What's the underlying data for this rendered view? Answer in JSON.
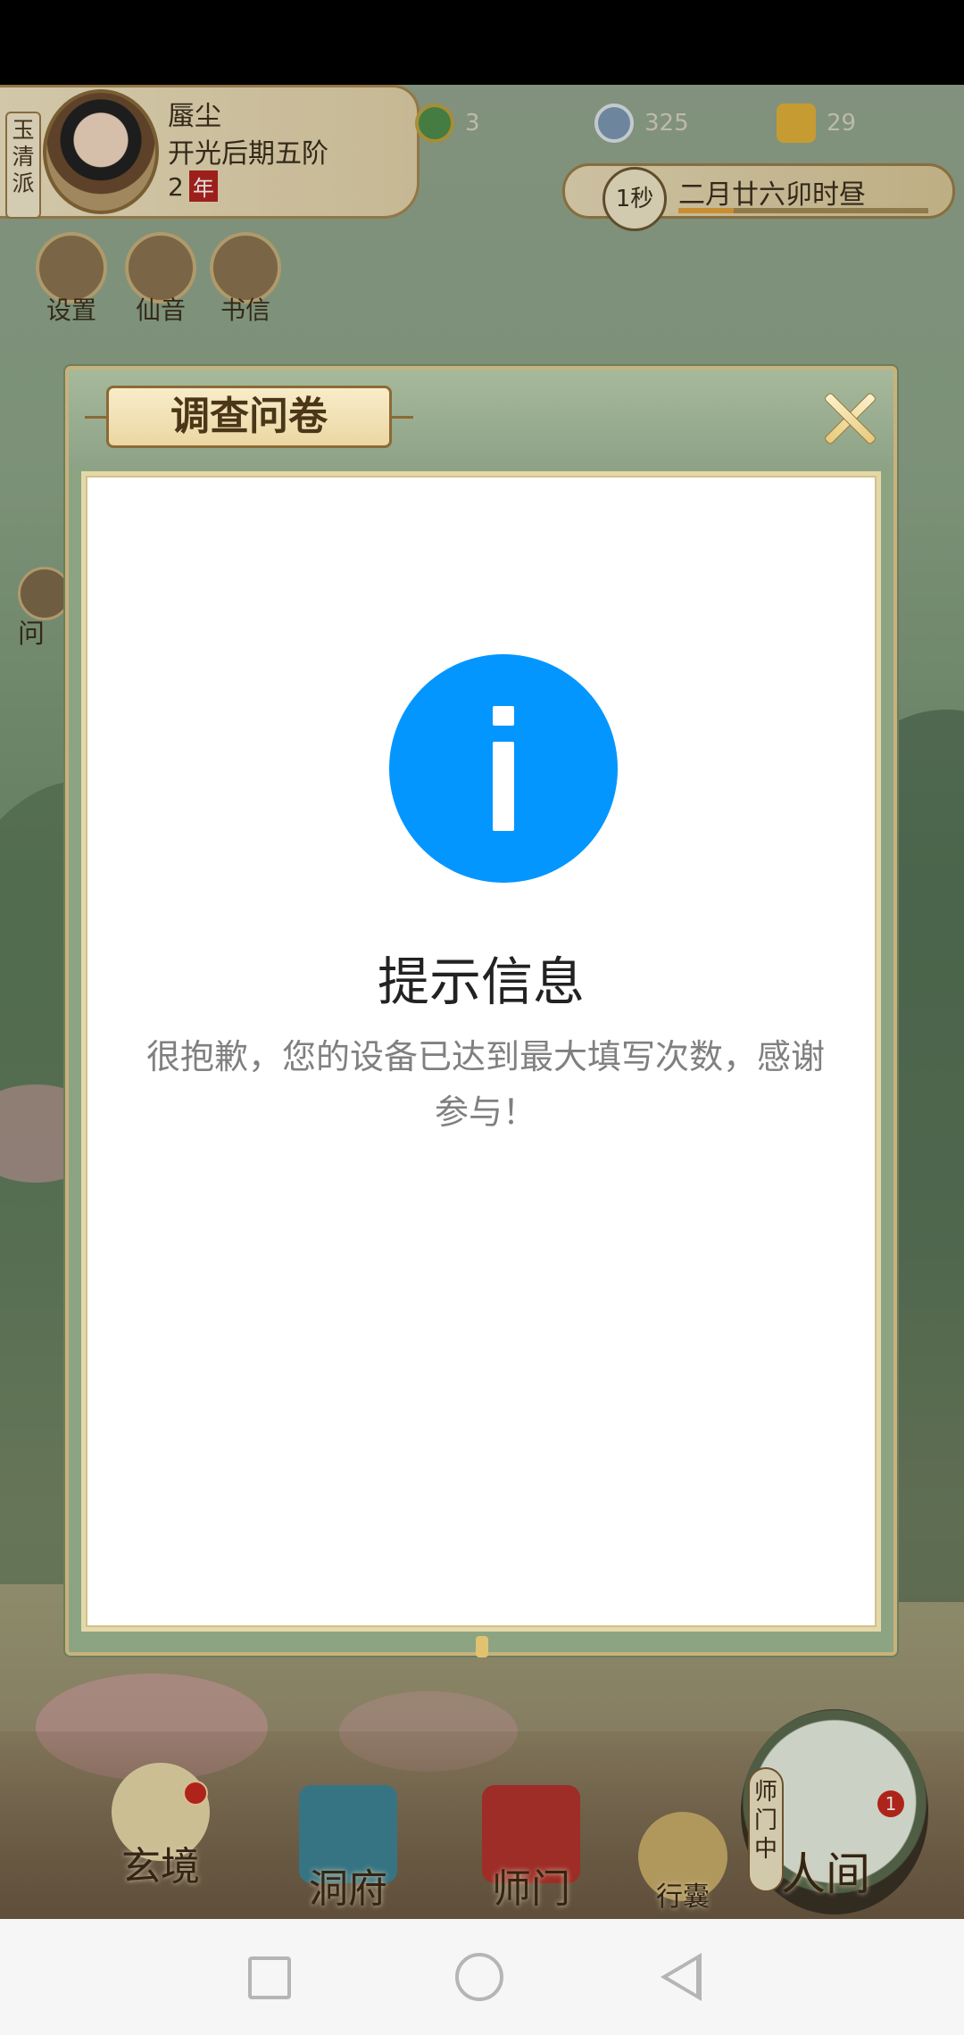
{
  "hud": {
    "sect": "玉清派",
    "player_name": "蜃尘",
    "player_rank": "开光后期五阶",
    "years_value": "2",
    "years_unit": "年",
    "resources": [
      {
        "icon": "jade-icon",
        "value": "3"
      },
      {
        "icon": "coin-icon",
        "value": "325"
      },
      {
        "icon": "gold-token-icon",
        "value": "29"
      }
    ],
    "time_circle": "1秒",
    "time_text": "二月廿六卯时昼",
    "time_progress": 0.22
  },
  "top_buttons": [
    {
      "label": "设置",
      "icon": "settings-icon"
    },
    {
      "label": "仙音",
      "icon": "music-icon"
    },
    {
      "label": "书信",
      "icon": "letter-icon"
    }
  ],
  "side_button": {
    "label": "问",
    "icon": "question-icon"
  },
  "bottom_nav": [
    {
      "label": "玄境",
      "icon": "realm-icon"
    },
    {
      "label": "洞府",
      "icon": "cave-icon"
    },
    {
      "label": "师门",
      "icon": "sect-icon"
    },
    {
      "label": "行囊",
      "icon": "bag-icon"
    }
  ],
  "world_button": {
    "vertical_label": "师门中",
    "label": "人间",
    "badge": "1"
  },
  "dialog": {
    "title": "调查问卷",
    "icon": "info-icon",
    "message_title": "提示信息",
    "message_body": "很抱歉，您的设备已达到最大填写次数，感谢参与！"
  },
  "system_nav": {
    "buttons": [
      "recent-apps",
      "home",
      "back"
    ]
  }
}
